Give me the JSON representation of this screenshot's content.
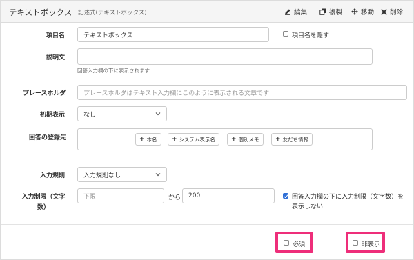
{
  "header": {
    "title": "テキストボックス",
    "subtitle": "記述式(テキストボックス)",
    "edit_label": "編集",
    "duplicate_label": "複製",
    "move_label": "移動",
    "delete_label": "削除"
  },
  "form": {
    "item_name": {
      "label": "項目名",
      "value": "テキストボックス",
      "hide_label": "項目名を隠す",
      "hide_checked": false
    },
    "description": {
      "label": "説明文",
      "value": "",
      "help": "回答入力欄の下に表示されます"
    },
    "placeholder": {
      "label": "プレースホルダ",
      "placeholder": "プレースホルダはテキスト入力欄にこのように表示される文章です"
    },
    "initial": {
      "label": "初期表示",
      "selected": "なし"
    },
    "registration": {
      "label": "回答の登録先",
      "buttons": [
        "本名",
        "システム表示名",
        "個別メモ",
        "友だち情報"
      ]
    },
    "input_rule": {
      "label": "入力規則",
      "selected": "入力規則なし"
    },
    "limit": {
      "label_line1": "入力制限（文字",
      "label_line2": "数）",
      "min_placeholder": "下限",
      "between": "から",
      "max_value": "200",
      "show_label_line1": "回答入力欄の下に入力制限（文字数）を",
      "show_label_line2": "表示しない",
      "show_checked": true
    }
  },
  "footer": {
    "required_label": "必須",
    "required_checked": false,
    "hidden_label": "非表示",
    "hidden_checked": false
  },
  "colors": {
    "highlight": "#ee2e7a",
    "checked": "#2f6fd6"
  }
}
